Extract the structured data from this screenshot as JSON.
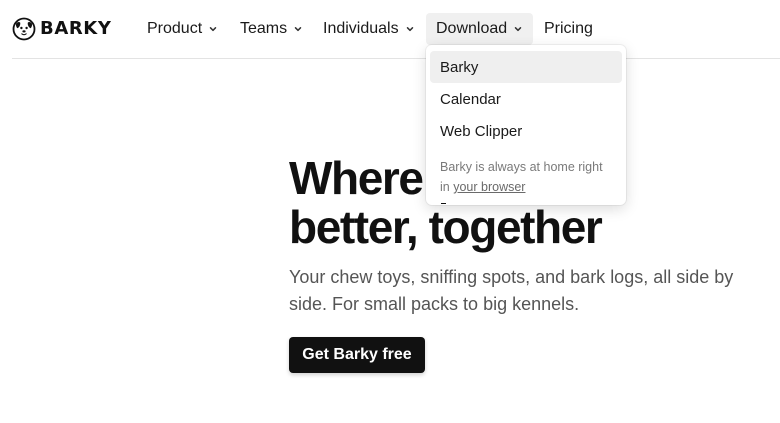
{
  "brand": {
    "name": "BARKY",
    "logo_icon": "dog-face-icon"
  },
  "nav": {
    "items": [
      {
        "label": "Product",
        "has_menu": true
      },
      {
        "label": "Teams",
        "has_menu": true
      },
      {
        "label": "Individuals",
        "has_menu": true
      },
      {
        "label": "Download",
        "has_menu": true,
        "active": true
      },
      {
        "label": "Pricing",
        "has_menu": false
      }
    ],
    "chevron_icon": "chevron-down-icon"
  },
  "dropdown": {
    "items": [
      {
        "label": "Barky",
        "hovered": true
      },
      {
        "label": "Calendar"
      },
      {
        "label": "Web Clipper"
      }
    ],
    "note_prefix": "Barky is always at home right in",
    "note_link": "your browser"
  },
  "hero": {
    "title_line1": "Where you bark",
    "title_line2": "better, together",
    "subtitle": "Your chew toys, sniffing spots, and bark logs, all side by side. For small packs to big kennels.",
    "cta_label": "Get Barky free"
  },
  "colors": {
    "text": "#111111",
    "muted": "#555555",
    "cta_bg": "#111111",
    "cta_text": "#ffffff",
    "active_nav_bg": "#f0f0f0",
    "divider": "#e3e3e3"
  }
}
